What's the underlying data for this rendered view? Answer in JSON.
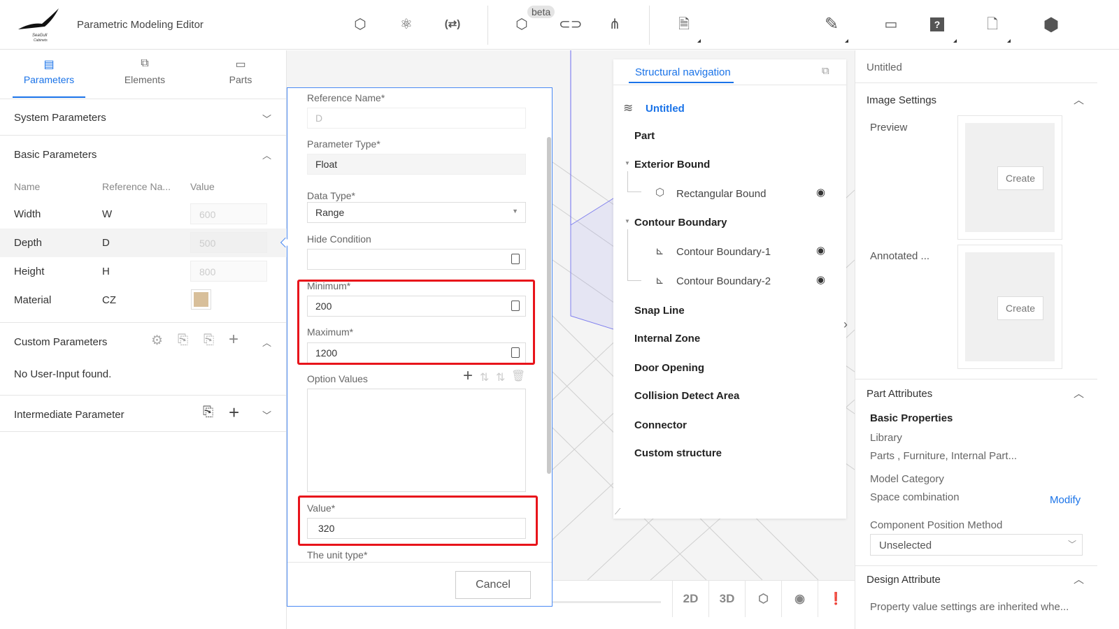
{
  "header": {
    "title": "Parametric Modeling Editor",
    "logo_text": "SeaGull Cabinets",
    "beta_badge": "beta",
    "icons": [
      "cube-grid-icon",
      "atom-icon",
      "swap-brackets-icon",
      "cube-fx-icon",
      "link-icon",
      "nodes-icon",
      "document-settings-icon",
      "pencil-icon",
      "monitor-chart-icon",
      "help-icon",
      "file-icon",
      "hexagon-icon"
    ]
  },
  "left": {
    "tabs": [
      {
        "label": "Parameters",
        "active": true
      },
      {
        "label": "Elements"
      },
      {
        "label": "Parts"
      }
    ],
    "system_parameters": "System Parameters",
    "basic_parameters": {
      "title": "Basic Parameters",
      "columns": [
        "Name",
        "Reference Na...",
        "Value"
      ],
      "rows": [
        {
          "name": "Width",
          "ref": "W",
          "value": "600"
        },
        {
          "name": "Depth",
          "ref": "D",
          "value": "500"
        },
        {
          "name": "Height",
          "ref": "H",
          "value": "800"
        },
        {
          "name": "Material",
          "ref": "CZ",
          "value": ""
        }
      ]
    },
    "custom_parameters": {
      "title": "Custom Parameters",
      "empty": "No User-Input found."
    },
    "intermediate_parameter": "Intermediate Parameter"
  },
  "dialog": {
    "reference_name_label": "Reference Name*",
    "reference_name_value": "D",
    "parameter_type_label": "Parameter Type*",
    "parameter_type_value": "Float",
    "data_type_label": "Data Type*",
    "data_type_value": "Range",
    "hide_condition_label": "Hide Condition",
    "minimum_label": "Minimum*",
    "minimum_value": "200",
    "maximum_label": "Maximum*",
    "maximum_value": "1200",
    "option_values_label": "Option Values",
    "value_label": "Value*",
    "value_value": "320",
    "unit_type_label": "The unit type*",
    "cancel": "Cancel"
  },
  "nav": {
    "tab": "Structural navigation",
    "root": "Untitled",
    "items": {
      "part": "Part",
      "exterior_bound": "Exterior Bound",
      "rectangular_bound": "Rectangular Bound",
      "contour_boundary": "Contour Boundary",
      "contour_1": "Contour Boundary-1",
      "contour_2": "Contour Boundary-2",
      "snap_line": "Snap Line",
      "internal_zone": "Internal Zone",
      "door_opening": "Door Opening",
      "collision": "Collision Detect Area",
      "connector": "Connector",
      "custom": "Custom structure"
    }
  },
  "bottombar": {
    "b2d": "2D",
    "b3d": "3D"
  },
  "right": {
    "title": "Untitled",
    "image_settings": "Image Settings",
    "preview": "Preview",
    "annotated": "Annotated ...",
    "create": "Create",
    "part_attributes": "Part Attributes",
    "basic_properties": "Basic Properties",
    "library_label": "Library",
    "library_value": "Parts , Furniture, Internal Part...",
    "model_category": "Model Category",
    "space_combination": "Space combination",
    "modify": "Modify",
    "position_method_label": "Component Position Method",
    "position_method_value": "Unselected",
    "design_attribute": "Design Attribute",
    "design_note": "Property value settings are inherited whe..."
  },
  "colors": {
    "accent": "#1a73e8",
    "highlight": "#e8141b"
  }
}
